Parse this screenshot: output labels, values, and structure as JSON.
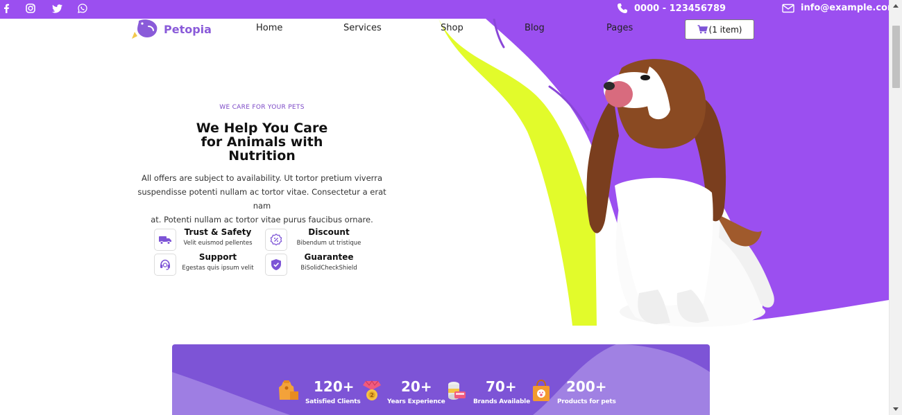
{
  "topbar": {
    "social": [
      {
        "icon": "facebook-icon"
      },
      {
        "icon": "instagram-icon"
      },
      {
        "icon": "twitter-icon"
      },
      {
        "icon": "whatsapp-icon"
      }
    ],
    "phone": "0000 - 123456789",
    "email": "info@example.com"
  },
  "nav": {
    "logo_text": "Petopia",
    "items": [
      "Home",
      "Services",
      "Shop",
      "Blog",
      "Pages"
    ],
    "cart_label": "(1 item)"
  },
  "hero": {
    "eyebrow": "WE CARE FOR YOUR PETS",
    "headline_lines": [
      "We Help You Care",
      "for Animals with",
      "Nutrition"
    ],
    "paragraph_lines": [
      "All offers are subject to availability. Ut tortor pretium viverra",
      "suspendisse potenti nullam ac tortor vitae. Consectetur a erat nam",
      "at. Potenti nullam ac tortor vitae purus faucibus ornare."
    ],
    "features": [
      {
        "title": "Trust & Safety",
        "subtitle": "Velit euismod pellentes",
        "icon": "truck-icon"
      },
      {
        "title": "Discount",
        "subtitle": "Bibendum ut tristique",
        "icon": "discount-icon"
      },
      {
        "title": "Support",
        "subtitle": "Egestas quis ipsum velit",
        "icon": "support-icon"
      },
      {
        "title": "Guarantee",
        "subtitle": "BiSolidCheckShield",
        "icon": "check-shield-icon"
      }
    ]
  },
  "stats": [
    {
      "value": "120+",
      "label": "Satisfied Clients",
      "icon": "pet-food-bag-icon"
    },
    {
      "value": "20+",
      "label": "Years Experience",
      "icon": "medal-icon"
    },
    {
      "value": "70+",
      "label": "Brands Available",
      "icon": "pet-food-can-icon"
    },
    {
      "value": "200+",
      "label": "Products for pets",
      "icon": "shopping-bag-icon"
    }
  ],
  "colors": {
    "brand_purple": "#9b4ff0",
    "accent_lime": "#e2fb2b",
    "stats_purple": "#7d54d6",
    "eyebrow_purple": "#7b47c6"
  }
}
